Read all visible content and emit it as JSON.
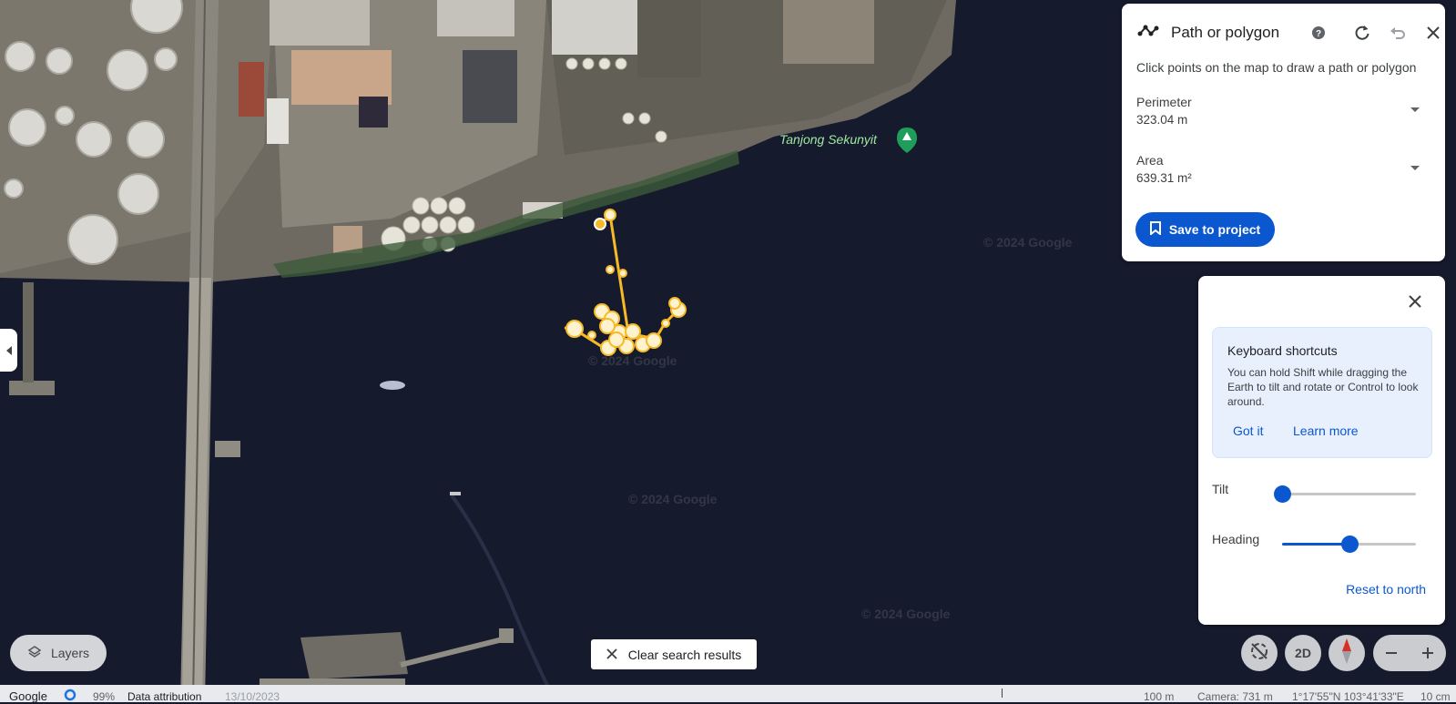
{
  "measure_panel": {
    "title": "Path or polygon",
    "instruction": "Click points on the map to draw a path or polygon",
    "perimeter": {
      "label": "Perimeter",
      "value": "323.04 m"
    },
    "area": {
      "label": "Area",
      "value": "639.31 m²"
    },
    "save_label": "Save to project"
  },
  "nav_panel": {
    "shortcuts": {
      "title": "Keyboard shortcuts",
      "body": "You can hold Shift while dragging the Earth to tilt and rotate or Control to look around.",
      "got_it": "Got it",
      "learn_more": "Learn more"
    },
    "tilt": {
      "label": "Tilt",
      "value": 0
    },
    "heading": {
      "label": "Heading",
      "value": 0.5
    },
    "reset_label": "Reset to north"
  },
  "map": {
    "place_label": "Tanjong Sekunyit",
    "watermark": "© 2024 Google"
  },
  "layers_label": "Layers",
  "clear_label": "Clear search results",
  "view_mode_label": "2D",
  "status": {
    "brand": "Google",
    "loading": "99%",
    "attribution": "Data attribution",
    "date": "13/10/2023",
    "scale": "100 m",
    "camera": "Camera: 731 m",
    "coords": "1°17'55\"N 103°41'33\"E",
    "elevation": "10 cm"
  },
  "colors": {
    "accent": "#0b57d0",
    "path": "#f7b928",
    "water": "#151a2c",
    "place_label": "#9ee8a0"
  }
}
